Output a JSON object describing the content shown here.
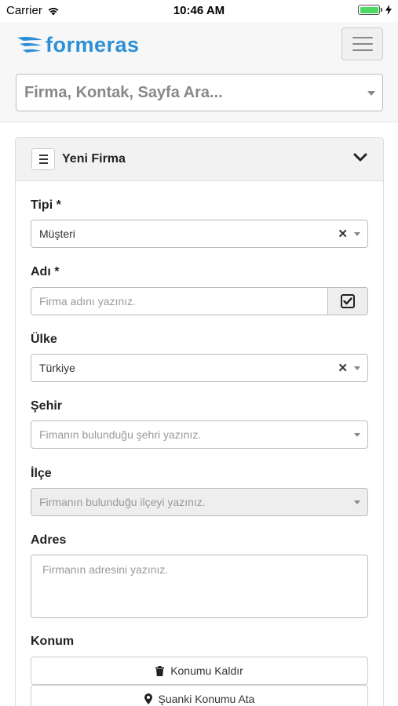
{
  "status_bar": {
    "carrier": "Carrier",
    "time": "10:46 AM",
    "battery_level": 1.0
  },
  "header": {
    "logo_text": "formeras",
    "search_placeholder": "Firma, Kontak, Sayfa Ara..."
  },
  "panel": {
    "title": "Yeni Firma",
    "fields": {
      "tipi": {
        "label": "Tipi *",
        "value": "Müşteri"
      },
      "adi": {
        "label": "Adı *",
        "placeholder": "Firma adını yazınız."
      },
      "ulke": {
        "label": "Ülke",
        "value": "Türkiye"
      },
      "sehir": {
        "label": "Şehir",
        "placeholder": "Fimanın bulunduğu şehri yazınız."
      },
      "ilce": {
        "label": "İlçe",
        "placeholder": "Firmanın bulunduğu ilçeyi yazınız."
      },
      "adres": {
        "label": "Adres",
        "placeholder": "Firmanın adresini yazınız."
      },
      "konum": {
        "label": "Konum"
      }
    },
    "buttons": {
      "remove_location": "Konumu Kaldır",
      "set_current_location": "Şuanki Konumu Ata"
    }
  },
  "icons": {
    "wifi": "wifi-icon",
    "battery": "battery-icon",
    "charging": "charging-bolt-icon",
    "menu": "hamburger-icon",
    "clear": "clear-x-icon",
    "dropdown": "chevron-down-icon",
    "checkbox": "checkbox-checked-icon",
    "trash": "trash-icon",
    "map_marker": "map-marker-icon"
  },
  "colors": {
    "brand": "#2d8fd6",
    "battery": "#4cd964"
  }
}
